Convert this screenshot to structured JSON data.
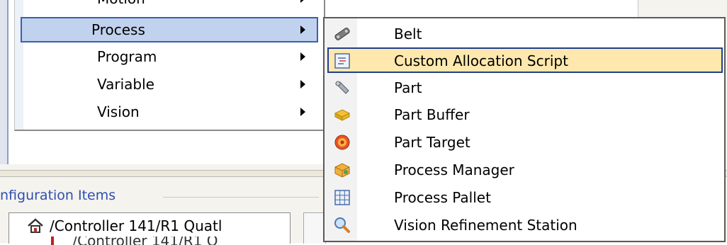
{
  "parent_menu": {
    "cut_item_label": "Motion",
    "items": [
      {
        "label": "Process",
        "selected": true
      },
      {
        "label": "Program",
        "selected": false
      },
      {
        "label": "Variable",
        "selected": false
      },
      {
        "label": "Vision",
        "selected": false
      }
    ]
  },
  "submenu": {
    "items": [
      {
        "label": "Belt",
        "icon": "belt-icon"
      },
      {
        "label": "Custom Allocation Script",
        "icon": "script-icon",
        "highlighted": true
      },
      {
        "label": "Part",
        "icon": "part-icon"
      },
      {
        "label": "Part Buffer",
        "icon": "part-buffer-icon"
      },
      {
        "label": "Part Target",
        "icon": "part-target-icon"
      },
      {
        "label": "Process Manager",
        "icon": "process-manager-icon"
      },
      {
        "label": "Process Pallet",
        "icon": "process-pallet-icon"
      },
      {
        "label": "Vision Refinement Station",
        "icon": "vision-refinement-icon"
      }
    ]
  },
  "config": {
    "title": "nfiguration Items",
    "tree_item": "/Controller 141/R1 Quatl",
    "tree_item_partial": "/Controller 141/R1 Q"
  },
  "colors": {
    "highlight_bg": "#ffe8ad",
    "highlight_border": "#1f3f8c",
    "selected_bg": "#c1d2ee",
    "selected_border": "#3a5fb0",
    "config_title": "#2f4fb0"
  }
}
